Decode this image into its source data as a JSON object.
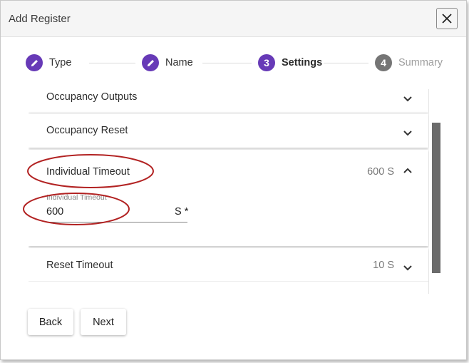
{
  "dialog": {
    "title": "Add Register"
  },
  "stepper": {
    "accent_color": "#673ab7",
    "inactive_color": "#757575",
    "steps": [
      {
        "label": "Type",
        "icon": "pencil-icon",
        "state": "completed"
      },
      {
        "label": "Name",
        "icon": "pencil-icon",
        "state": "completed"
      },
      {
        "number": "3",
        "label": "Settings",
        "state": "active"
      },
      {
        "number": "4",
        "label": "Summary",
        "state": "inactive"
      }
    ]
  },
  "panels": [
    {
      "title": "Occupancy Outputs",
      "expanded": false
    },
    {
      "title": "Occupancy Reset",
      "expanded": false
    },
    {
      "title": "Individual Timeout",
      "value": "600 S",
      "expanded": true,
      "field": {
        "label": "Individual Timeout",
        "value": "600",
        "unit": "S *"
      }
    },
    {
      "title": "Reset Timeout",
      "value": "10 S",
      "expanded": false
    }
  ],
  "annotation_color": "#b22222",
  "buttons": {
    "back": "Back",
    "next": "Next"
  }
}
